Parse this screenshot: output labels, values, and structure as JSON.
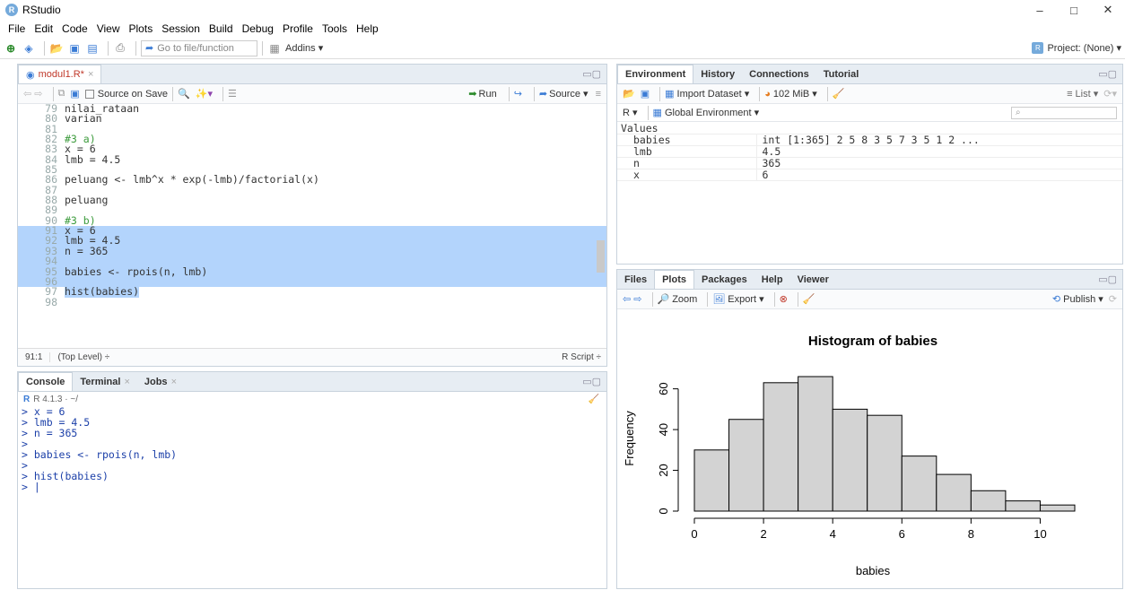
{
  "window": {
    "title": "RStudio",
    "min": "–",
    "max": "□",
    "close": "✕"
  },
  "menu": [
    "File",
    "Edit",
    "Code",
    "View",
    "Plots",
    "Session",
    "Build",
    "Debug",
    "Profile",
    "Tools",
    "Help"
  ],
  "toolbar": {
    "goto_placeholder": "Go to file/function",
    "addins": "Addins ▾",
    "project": "Project: (None) ▾"
  },
  "editor": {
    "tab_label": "modul1.R*",
    "source_on_save": "Source on Save",
    "run": "Run",
    "source": "Source ▾",
    "cursor_pos": "91:1",
    "scope": "(Top Level) ÷",
    "filetype": "R Script ÷",
    "lines": [
      {
        "n": "79",
        "t": "nilai_rataan",
        "cls": "",
        "sel": false
      },
      {
        "n": "80",
        "t": "varian",
        "cls": "",
        "sel": false
      },
      {
        "n": "81",
        "t": "",
        "cls": "",
        "sel": false
      },
      {
        "n": "82",
        "t": "#3 a)",
        "cls": "cmt",
        "sel": false
      },
      {
        "n": "83",
        "t": "x = 6",
        "cls": "",
        "sel": false
      },
      {
        "n": "84",
        "t": "lmb = 4.5",
        "cls": "",
        "sel": false
      },
      {
        "n": "85",
        "t": "",
        "cls": "",
        "sel": false
      },
      {
        "n": "86",
        "t": "peluang <- lmb^x * exp(-lmb)/factorial(x)",
        "cls": "",
        "sel": false
      },
      {
        "n": "87",
        "t": "",
        "cls": "",
        "sel": false
      },
      {
        "n": "88",
        "t": "peluang",
        "cls": "",
        "sel": false
      },
      {
        "n": "89",
        "t": "",
        "cls": "",
        "sel": false
      },
      {
        "n": "90",
        "t": "#3 b)",
        "cls": "cmt",
        "sel": false
      },
      {
        "n": "91",
        "t": "x = 6",
        "cls": "",
        "sel": true
      },
      {
        "n": "92",
        "t": "lmb = 4.5",
        "cls": "",
        "sel": true
      },
      {
        "n": "93",
        "t": "n = 365",
        "cls": "",
        "sel": true
      },
      {
        "n": "94",
        "t": "",
        "cls": "",
        "sel": true
      },
      {
        "n": "95",
        "t": "babies <- rpois(n, lmb)",
        "cls": "",
        "sel": true
      },
      {
        "n": "96",
        "t": "",
        "cls": "",
        "sel": true
      },
      {
        "n": "97",
        "t": "hist(babies)",
        "cls": "",
        "sel": "partial"
      },
      {
        "n": "98",
        "t": "",
        "cls": "",
        "sel": false
      }
    ]
  },
  "console": {
    "tabs": [
      "Console",
      "Terminal",
      "Jobs"
    ],
    "version": "R 4.1.3 · ~/",
    "lines": [
      "> x = 6",
      "> lmb = 4.5",
      "> n = 365",
      ">",
      "> babies <- rpois(n, lmb)",
      ">",
      "> hist(babies)",
      "> |"
    ]
  },
  "environment": {
    "tabs": [
      "Environment",
      "History",
      "Connections",
      "Tutorial"
    ],
    "import_dataset": "Import Dataset ▾",
    "memory": "102 MiB ▾",
    "list_view": "List ▾",
    "r_scope": "R ▾",
    "global_env": "Global Environment ▾",
    "section": "Values",
    "rows": [
      {
        "name": "babies",
        "value": "int [1:365] 2 5 8 3 5 7 3 5 1 2 ..."
      },
      {
        "name": "lmb",
        "value": "4.5"
      },
      {
        "name": "n",
        "value": "365"
      },
      {
        "name": "x",
        "value": "6"
      }
    ]
  },
  "plots": {
    "tabs": [
      "Files",
      "Plots",
      "Packages",
      "Help",
      "Viewer"
    ],
    "zoom": "Zoom",
    "export": "Export ▾",
    "publish": "Publish ▾"
  },
  "chart_data": {
    "type": "bar",
    "title": "Histogram of babies",
    "xlabel": "babies",
    "ylabel": "Frequency",
    "bin_edges": [
      0,
      1,
      2,
      3,
      4,
      5,
      6,
      7,
      8,
      9,
      10,
      11
    ],
    "values": [
      30,
      45,
      63,
      66,
      50,
      47,
      27,
      18,
      10,
      5,
      3
    ],
    "xticks": [
      "0",
      "2",
      "4",
      "6",
      "8",
      "10"
    ],
    "yticks": [
      "0",
      "20",
      "40",
      "60"
    ],
    "xlim": [
      0,
      11
    ],
    "ylim": [
      0,
      66
    ],
    "bar_color": "#d3d3d3"
  }
}
